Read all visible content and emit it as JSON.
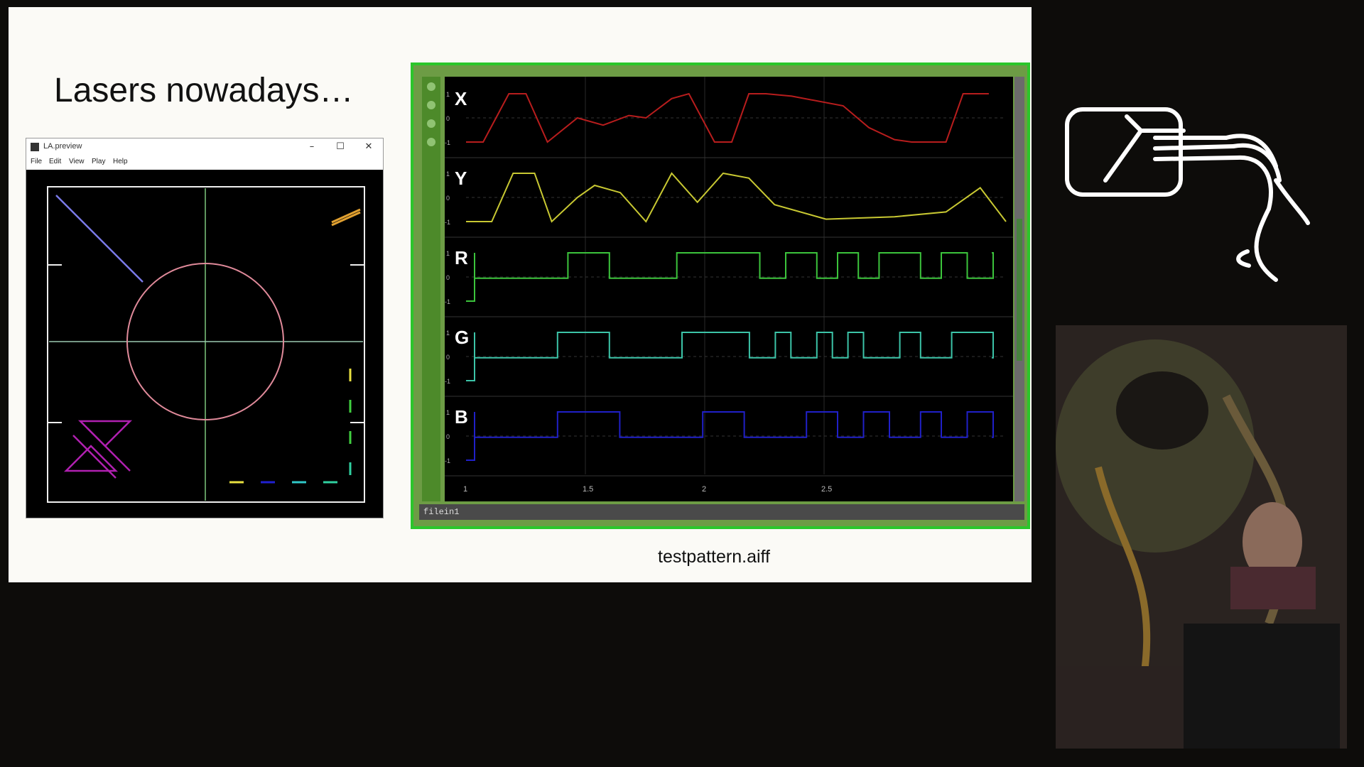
{
  "slide": {
    "title": "Lasers nowadays…",
    "caption": "testpattern.aiff"
  },
  "preview_window": {
    "title": "LA.preview",
    "menu": [
      "File",
      "Edit",
      "View",
      "Play",
      "Help"
    ],
    "controls": {
      "minimize": "–",
      "maximize": "☐",
      "close": "✕"
    }
  },
  "wave_panel": {
    "footer_label": "filein1",
    "channels": [
      {
        "label": "X",
        "color": "#b81d1d",
        "tick_top": "1",
        "tick_mid": "0",
        "tick_bottom": "-1"
      },
      {
        "label": "Y",
        "color": "#c8c832",
        "tick_top": "1",
        "tick_mid": "0",
        "tick_bottom": "-1"
      },
      {
        "label": "R",
        "color": "#3cc43c",
        "tick_top": "1",
        "tick_mid": "0",
        "tick_bottom": "-1"
      },
      {
        "label": "G",
        "color": "#3cc4a8",
        "tick_top": "1",
        "tick_mid": "0",
        "tick_bottom": "-1"
      },
      {
        "label": "B",
        "color": "#2020c8",
        "tick_top": "1",
        "tick_mid": "0",
        "tick_bottom": "-1"
      }
    ],
    "x_ticks": [
      "1",
      "1.5",
      "2",
      "2.5"
    ]
  },
  "icons": {
    "sidebar": [
      "target-icon",
      "curve-icon",
      "arrow-right-icon",
      "hand-icon"
    ]
  }
}
